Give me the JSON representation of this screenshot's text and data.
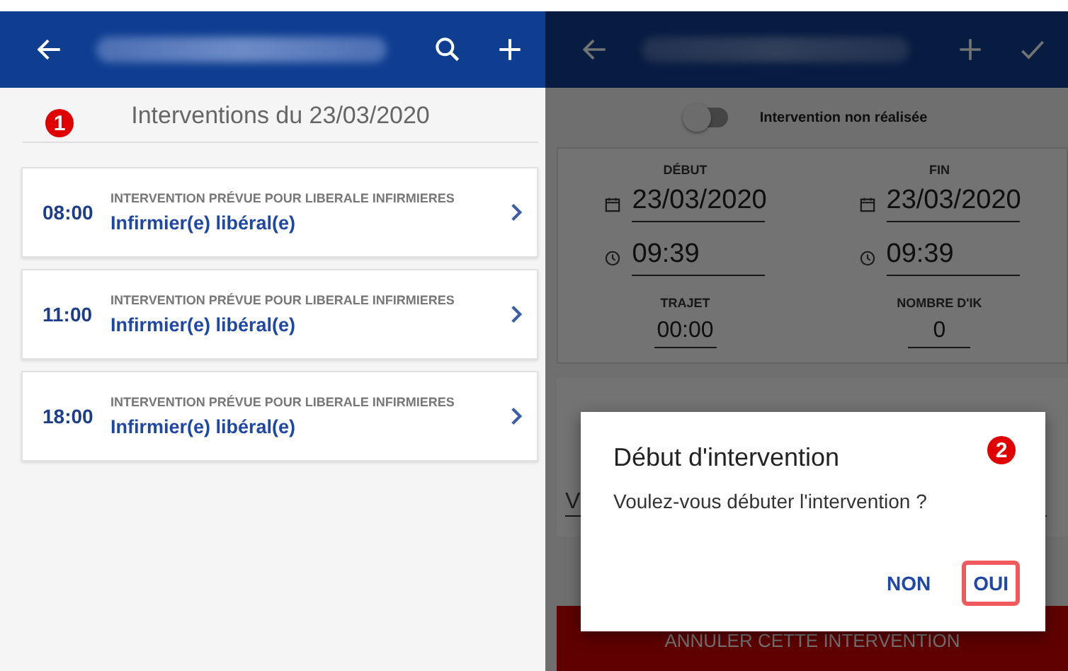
{
  "list_screen": {
    "heading": "Interventions du 23/03/2020",
    "marker": "1",
    "interventions": [
      {
        "time": "08:00",
        "subtitle": "INTERVENTION PRÉVUE POUR LIBERALE INFIRMIERES",
        "title": "Infirmier(e) libéral(e)"
      },
      {
        "time": "11:00",
        "subtitle": "INTERVENTION PRÉVUE POUR LIBERALE INFIRMIERES",
        "title": "Infirmier(e) libéral(e)"
      },
      {
        "time": "18:00",
        "subtitle": "INTERVENTION PRÉVUE POUR LIBERALE INFIRMIERES",
        "title": "Infirmier(e) libéral(e)"
      }
    ]
  },
  "form_screen": {
    "toggle": {
      "label": "Intervention non réalisée",
      "on": false
    },
    "columns": [
      {
        "label": "DÉBUT",
        "date": "23/03/2020",
        "time": "09:39"
      },
      {
        "label": "FIN",
        "date": "23/03/2020",
        "time": "09:39"
      }
    ],
    "extras": [
      {
        "label": "TRAJET",
        "value": "00:00"
      },
      {
        "label": "NOMBRE D'IK",
        "value": "0"
      }
    ],
    "notes_field": {
      "value": "V"
    },
    "cancel_button": "ANNULER CETTE INTERVENTION"
  },
  "dialog": {
    "title": "Début d'intervention",
    "message": "Voulez-vous débuter l'intervention ?",
    "marker": "2",
    "buttons": [
      {
        "label": "NON",
        "highlighted": false
      },
      {
        "label": "OUI",
        "highlighted": true
      }
    ]
  }
}
